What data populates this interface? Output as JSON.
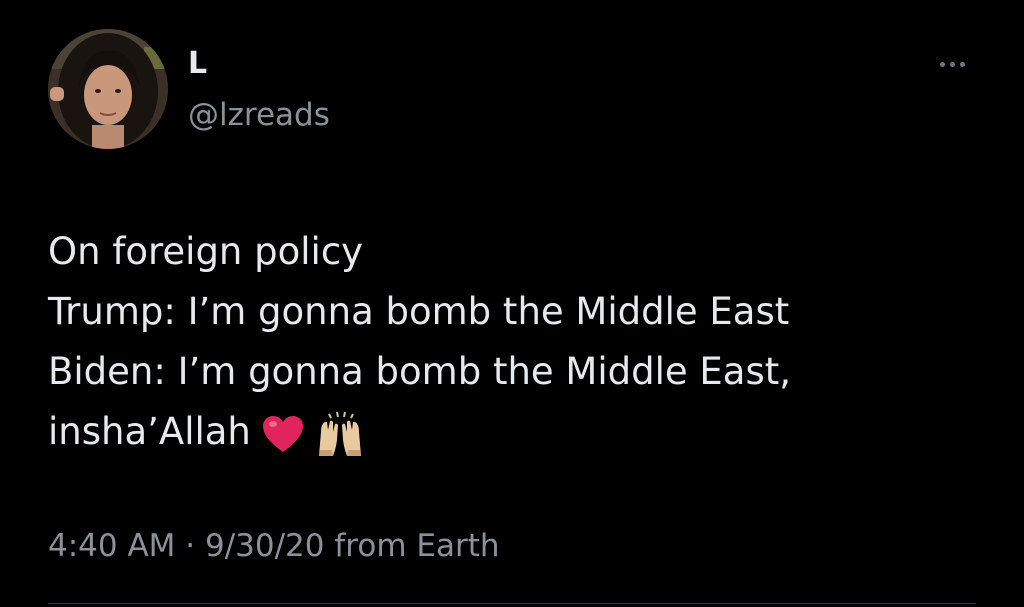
{
  "user": {
    "display_name": "L",
    "handle": "@lzreads",
    "avatar": "profile-photo"
  },
  "header": {
    "more_icon": "more-horizontal-icon"
  },
  "tweet": {
    "lines": [
      "On foreign policy",
      "Trump: I’m gonna bomb the Middle East",
      "Biden: I’m gonna bomb the Middle East,",
      "insha’Allah"
    ],
    "emojis": [
      "red-heart-emoji",
      "raising-hands-emoji"
    ]
  },
  "meta": {
    "time": "4:40 AM",
    "separator": "·",
    "date": "9/30/20",
    "source": "from Earth"
  },
  "colors": {
    "background": "#000000",
    "text": "#e7e9ea",
    "secondary": "#8b9197",
    "heart": "#e0245e"
  }
}
